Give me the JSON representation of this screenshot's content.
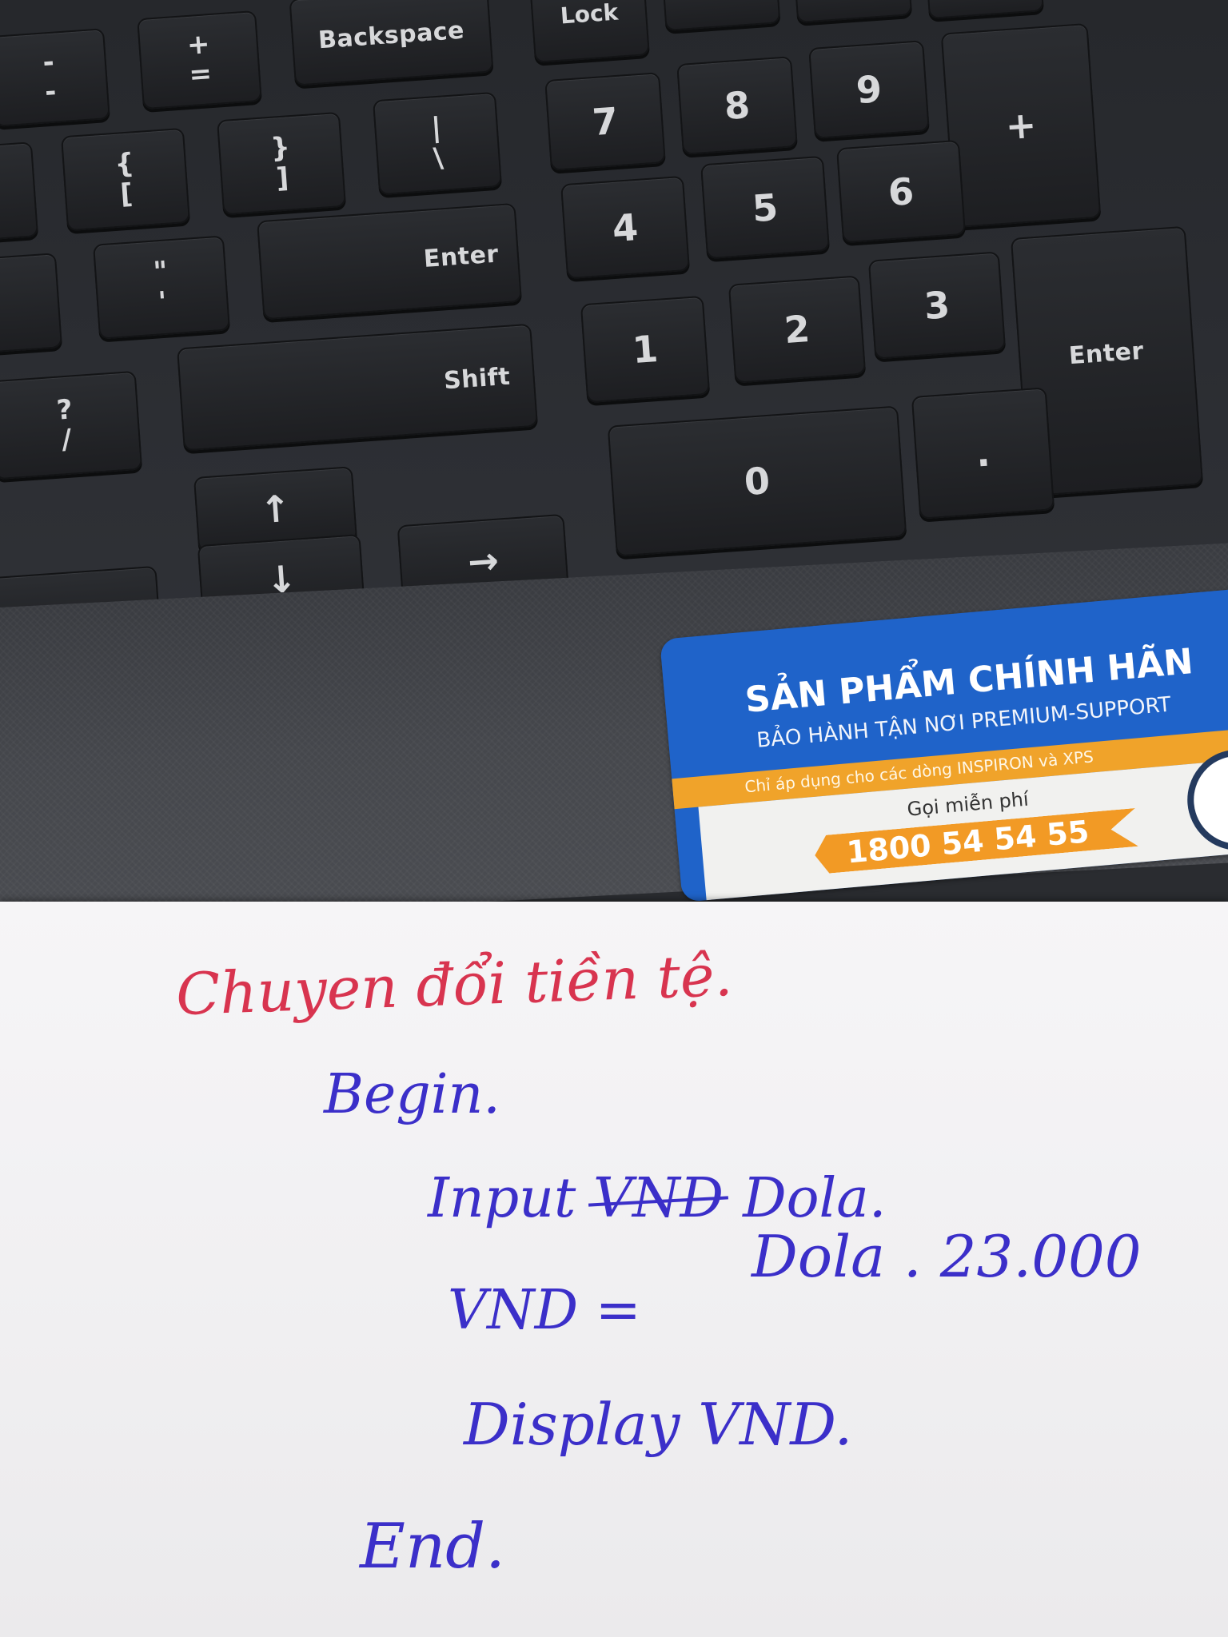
{
  "keyboard": {
    "backspace": "Backspace",
    "lock": "Lock",
    "enter_main": "Enter",
    "shift": "Shift",
    "numpad_enter": "Enter",
    "numpad_plus": "+",
    "numpad_dot": ".",
    "digits": [
      "7",
      "8",
      "9",
      "4",
      "5",
      "6",
      "1",
      "2",
      "3",
      "0"
    ],
    "plus_equals": [
      "+",
      "="
    ],
    "minus_underscore": [
      "-",
      "-"
    ],
    "brace_open": [
      "{",
      "["
    ],
    "brace_close": [
      "}",
      "]"
    ],
    "pipe_backslash": [
      "|",
      "\\"
    ],
    "quote": [
      "\"",
      "'"
    ],
    "question_slash": [
      "?",
      "/"
    ],
    "arrow_up": "↑",
    "arrow_down": "↓",
    "arrow_left": "←",
    "arrow_right": "→"
  },
  "sticker": {
    "headline": "SẢN PHẨM CHÍNH HÃN",
    "subline": "BẢO HÀNH TẬN NƠI PREMIUM-SUPPORT",
    "band_text": "Chỉ áp dụng cho các dòng INSPIRON và XPS",
    "call_label": "Gọi miễn phí",
    "phone": "1800 54 54 55"
  },
  "note": {
    "title": "Chuyen đổi tiền tệ.",
    "begin": "Begin.",
    "input_prefix": "Input",
    "input_struck": "VND",
    "input_rest": "Dola.",
    "assign_left": "VND =",
    "assign_right": "Dola . 23.000",
    "display": "Display VND.",
    "end": "End."
  }
}
